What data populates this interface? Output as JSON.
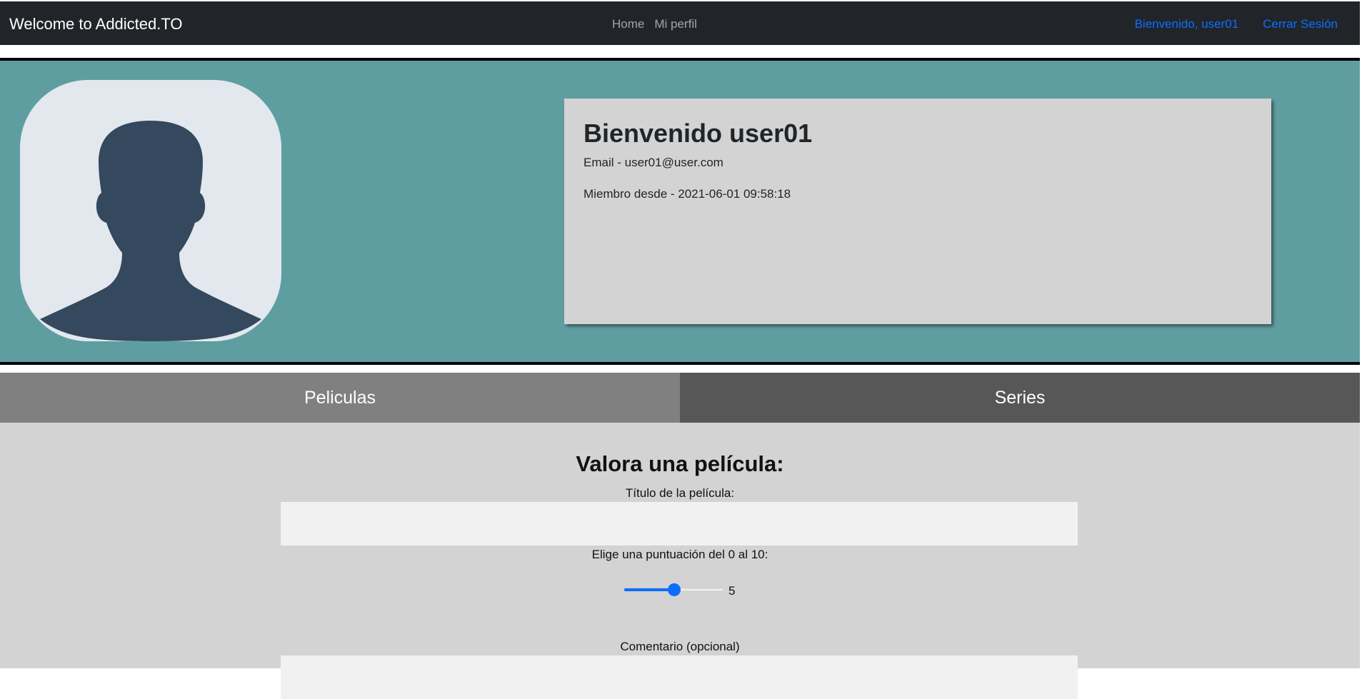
{
  "navbar": {
    "brand": "Welcome to Addicted.TO",
    "links": [
      "Home",
      "Mi perfil"
    ],
    "welcome": "Bienvenido, user01",
    "logout": "Cerrar Sesión"
  },
  "profile": {
    "greeting": "Bienvenido user01",
    "email": "Email - user01@user.com",
    "member_since": "Miembro desde - 2021-06-01 09:58:18"
  },
  "tabs": [
    "Peliculas",
    "Series"
  ],
  "form": {
    "title": "Valora una película:",
    "movie_label": "Título de la película:",
    "movie_value": "",
    "score_label": "Elige una puntuación del 0 al 10:",
    "score_min": 0,
    "score_max": 10,
    "score_value": 5,
    "comment_label": "Comentario (opcional)",
    "comment_value": ""
  },
  "colors": {
    "navbar": "#212529",
    "link": "#0d6efd",
    "band": "#5f9ea0",
    "card": "#d3d3d3",
    "tab_movies": "#808080",
    "tab_series": "#575757",
    "avatar_bg": "#e2e8ee",
    "avatar_figure": "#34495e"
  },
  "icons": {
    "avatar": "user-silhouette-icon"
  }
}
